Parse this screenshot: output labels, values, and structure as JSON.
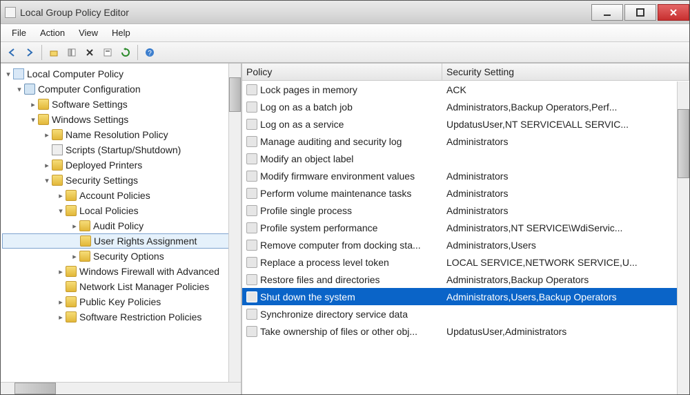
{
  "window": {
    "title": "Local Group Policy Editor"
  },
  "menu": {
    "items": [
      "File",
      "Action",
      "View",
      "Help"
    ]
  },
  "toolbar": {
    "buttons": [
      {
        "name": "back-icon"
      },
      {
        "name": "forward-icon"
      },
      {
        "name": "up-icon"
      },
      {
        "name": "show-hide-tree-icon"
      },
      {
        "name": "delete-icon"
      },
      {
        "name": "properties-icon"
      },
      {
        "name": "refresh-icon"
      },
      {
        "name": "help-icon"
      }
    ]
  },
  "tree": {
    "root": "Local Computer Policy",
    "nodes": [
      {
        "indent": 0,
        "expand": "▾",
        "icon": "computer",
        "label": "Computer Configuration"
      },
      {
        "indent": 1,
        "expand": "▸",
        "icon": "folder",
        "label": "Software Settings"
      },
      {
        "indent": 1,
        "expand": "▾",
        "icon": "folder",
        "label": "Windows Settings"
      },
      {
        "indent": 2,
        "expand": "▸",
        "icon": "folder",
        "label": "Name Resolution Policy"
      },
      {
        "indent": 2,
        "expand": "",
        "icon": "script",
        "label": "Scripts (Startup/Shutdown)"
      },
      {
        "indent": 2,
        "expand": "▸",
        "icon": "folder",
        "label": "Deployed Printers"
      },
      {
        "indent": 2,
        "expand": "▾",
        "icon": "folder",
        "label": "Security Settings"
      },
      {
        "indent": 3,
        "expand": "▸",
        "icon": "folder",
        "label": "Account Policies"
      },
      {
        "indent": 3,
        "expand": "▾",
        "icon": "folder",
        "label": "Local Policies"
      },
      {
        "indent": 4,
        "expand": "▸",
        "icon": "folder",
        "label": "Audit Policy"
      },
      {
        "indent": 4,
        "expand": "",
        "icon": "folder",
        "label": "User Rights Assignment",
        "selected": true
      },
      {
        "indent": 4,
        "expand": "▸",
        "icon": "folder",
        "label": "Security Options"
      },
      {
        "indent": 3,
        "expand": "▸",
        "icon": "folder",
        "label": "Windows Firewall with Advanced"
      },
      {
        "indent": 3,
        "expand": "",
        "icon": "folder",
        "label": "Network List Manager Policies"
      },
      {
        "indent": 3,
        "expand": "▸",
        "icon": "folder",
        "label": "Public Key Policies"
      },
      {
        "indent": 3,
        "expand": "▸",
        "icon": "folder",
        "label": "Software Restriction Policies"
      }
    ]
  },
  "list": {
    "columns": {
      "policy": "Policy",
      "setting": "Security Setting"
    },
    "rows": [
      {
        "policy": "Lock pages in memory",
        "setting": "ACK"
      },
      {
        "policy": "Log on as a batch job",
        "setting": "Administrators,Backup Operators,Perf..."
      },
      {
        "policy": "Log on as a service",
        "setting": "UpdatusUser,NT SERVICE\\ALL SERVIC..."
      },
      {
        "policy": "Manage auditing and security log",
        "setting": "Administrators"
      },
      {
        "policy": "Modify an object label",
        "setting": ""
      },
      {
        "policy": "Modify firmware environment values",
        "setting": "Administrators"
      },
      {
        "policy": "Perform volume maintenance tasks",
        "setting": "Administrators"
      },
      {
        "policy": "Profile single process",
        "setting": "Administrators"
      },
      {
        "policy": "Profile system performance",
        "setting": "Administrators,NT SERVICE\\WdiServic..."
      },
      {
        "policy": "Remove computer from docking sta...",
        "setting": "Administrators,Users"
      },
      {
        "policy": "Replace a process level token",
        "setting": "LOCAL SERVICE,NETWORK SERVICE,U..."
      },
      {
        "policy": "Restore files and directories",
        "setting": "Administrators,Backup Operators"
      },
      {
        "policy": "Shut down the system",
        "setting": "Administrators,Users,Backup Operators",
        "selected": true
      },
      {
        "policy": "Synchronize directory service data",
        "setting": ""
      },
      {
        "policy": "Take ownership of files or other obj...",
        "setting": "UpdatusUser,Administrators"
      }
    ]
  }
}
